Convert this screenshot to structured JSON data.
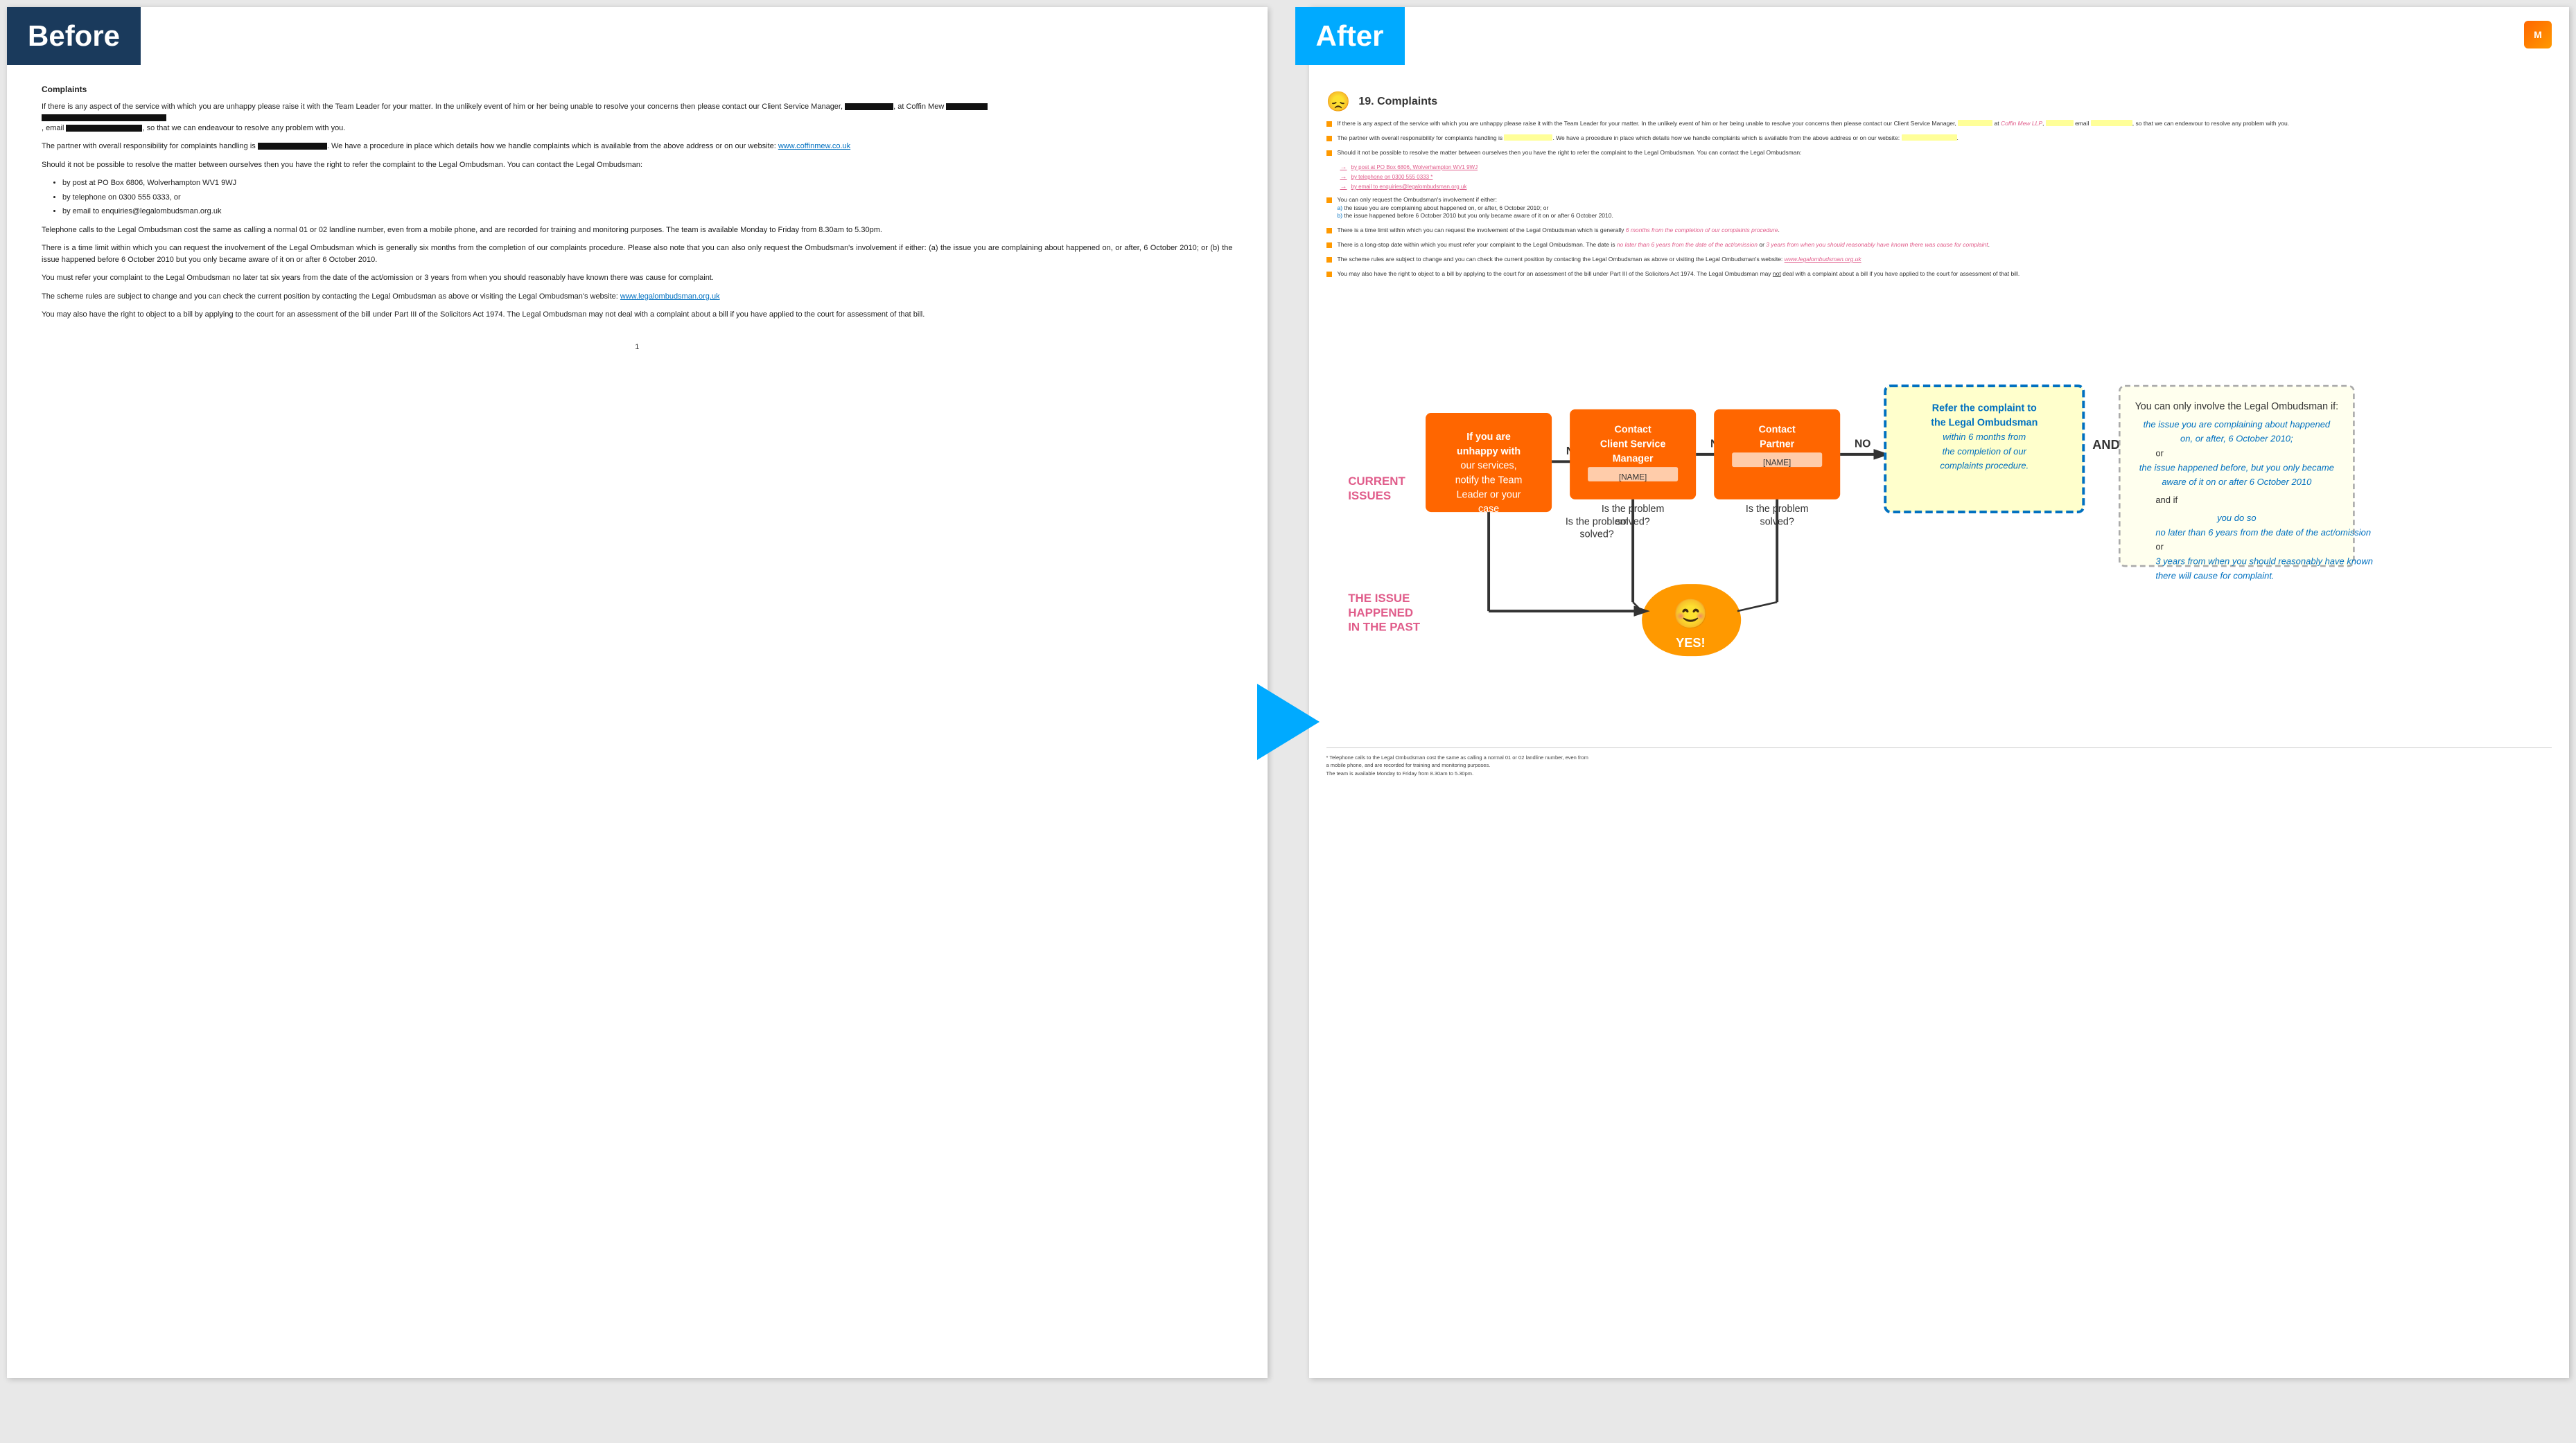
{
  "before": {
    "label": "Before",
    "document": {
      "heading": "Complaints",
      "paragraphs": [
        "If there is any aspect of the service with which you are unhappy please raise it with the Team Leader for your matter. In the unlikely event of him or her being unable to resolve your concerns then please contact our Client Service Manager, [REDACTED], at Coffin Mew [REDACTED] [REDACTED], email [REDACTED], so that we can endeavour to resolve any problem with you.",
        "The partner with overall responsibility for complaints handling is [REDACTED]. We have a procedure in place which details how we handle complaints which is available from the above address or on our website: www.coffinmew.co.uk",
        "Should it not be possible to resolve the matter between ourselves then you have the right to refer the complaint to the Legal Ombudsman. You can contact the Legal Ombudsman:",
        "Telephone calls to the Legal Ombudsman cost the same as calling a normal 01 or 02 landline number, even from a mobile phone, and are recorded for training and monitoring purposes. The team is available Monday to Friday from 8.30am to 5.30pm.",
        "There is a time limit within which you can request the involvement of the Legal Ombudsman which is generally six months from the completion of our complaints procedure. Please also note that you can also only request the Ombudsman's involvement if either: (a) the issue you are complaining about happened on, or after, 6 October 2010; or (b) the issue happened before 6 October 2010 but you only became aware of it on or after 6 October 2010.",
        "You must refer your complaint to the Legal Ombudsman no later tat six years from the date of the act/omission or 3 years from when you should reasonably have known there was cause for complaint.",
        "The scheme rules are subject to change and you can check the current position by contacting the Legal Ombudsman as above or visiting the Legal Ombudsman's website: www.legalombudsman.org.uk",
        "You may also have the right to object to a bill by applying to the court for an assessment of the bill under Part III of the Solicitors Act 1974. The Legal Ombudsman may not deal with a complaint about a bill if you have applied to the court for assessment of that bill."
      ],
      "list_items": [
        "by post at PO Box 6806, Wolverhampton WV1 9WJ",
        "by telephone on 0300 555 0333, or",
        "by email to enquiries@legalombudsman.org.uk"
      ],
      "page_number": "1"
    }
  },
  "after": {
    "label": "After",
    "section_number": "19.",
    "section_title": "Complaints",
    "bullets": [
      {
        "text": "If there is any aspect of the service with which you are unhappy please raise it with the Team Leader for your matter. In the unlikely event of him or her being unable to resolve your concerns then please contact our Client Service Manager, [NAME] at Coffin Mew LLP, [NAME] email [EMAIL], so that we can endeavour to resolve any problem with you."
      },
      {
        "text": "The partner with overall responsibility for complaints handling is [NAME]. We have a procedure in place which details how we handle complaints which is available from the above address or on our website: [WEBSITE]."
      },
      {
        "text": "Should it not be possible to resolve the matter between ourselves then you have the right to refer the complaint to the Legal Ombudsman. You can contact the Legal Ombudsman:"
      }
    ],
    "contact_links": [
      "by post at PO Box 6806, Wolverhampton WV1 9WJ",
      "by telephone on 0300 555 0333 *",
      "by email to enquiries@legalombudsman.org.uk"
    ],
    "bullets2": [
      {
        "text": "You can only request the Ombudsman's involvement if either:\na) the issue you are complaining about happened on, or after, 6 October 2010; or\nb) the issue happened before 6 October 2010 but you only became aware of it on or after 6 October 2010."
      },
      {
        "text": "There is a time limit within which you can request the involvement of the Legal Ombudsman which is generally 6 months from the completion of our complaints procedure."
      },
      {
        "text": "There is a long-stop date within which you must refer your complaint to the Legal Ombudsman. The date is no later than 6 years from the date of the act/omission or 3 years from when you should reasonably have known there was cause for complaint."
      },
      {
        "text": "The scheme rules are subject to change and you can check the current position by contacting the Legal Ombudsman as above or visiting the Legal Ombudsman's website: www.legalombudsman.org.uk"
      },
      {
        "text": "You may also have the right to object to a bill by applying to the court for an assessment of the bill under Part III of the Solicitors Act 1974. The Legal Ombudsman may not deal with a complaint about a bill if you have applied to the court for assessment of that bill."
      }
    ],
    "footnote": "* Telephone calls to the Legal Ombudsman cost the same as calling a normal 01 or 02 landline number, even from a mobile phone, and are recorded for training and monitoring purposes.\nThe team is available Monday to Friday from 8.30am to 5.30pm."
  },
  "arrow": {
    "color": "#00aaff"
  }
}
